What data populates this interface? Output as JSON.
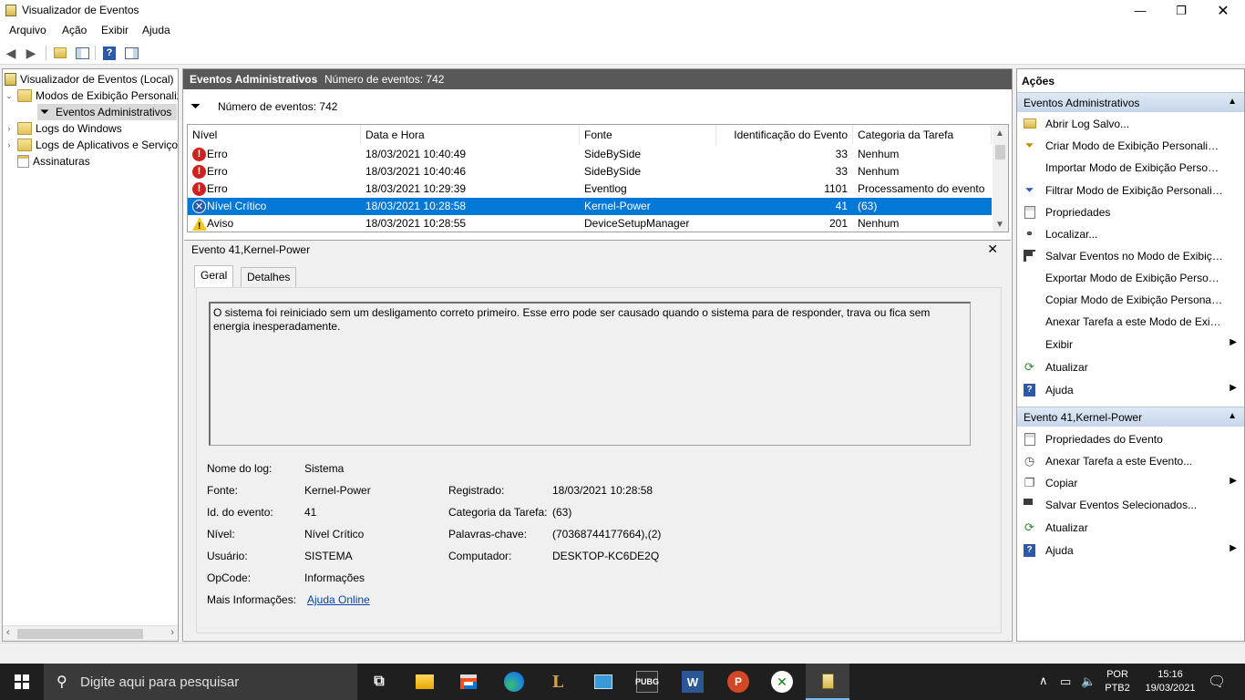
{
  "window": {
    "title": "Visualizador de Eventos",
    "minimize_icon": "minimize-icon",
    "maximize_icon": "restore-icon",
    "close_icon": "close-icon"
  },
  "menu": [
    "Arquivo",
    "Ação",
    "Exibir",
    "Ajuda"
  ],
  "tree": {
    "items": [
      {
        "label": "Visualizador de Eventos (Local)",
        "expander": ""
      },
      {
        "label": "Modos de Exibição Personalizados",
        "expander": "⌄"
      },
      {
        "label": "Eventos Administrativos",
        "expander": ""
      },
      {
        "label": "Logs do Windows",
        "expander": "›"
      },
      {
        "label": "Logs de Aplicativos e Serviços",
        "expander": "›"
      },
      {
        "label": "Assinaturas",
        "expander": ""
      }
    ]
  },
  "center": {
    "header_title": "Eventos Administrativos",
    "header_count": "Número de eventos: 742",
    "filter_text": "Número de eventos: 742",
    "columns": [
      "Nível",
      "Data e Hora",
      "Fonte",
      "Identificação do Evento",
      "Categoria da Tarefa"
    ],
    "rows": [
      {
        "level": "Erro",
        "datetime": "18/03/2021 10:40:49",
        "source": "SideBySide",
        "id": "33",
        "category": "Nenhum",
        "icon": "error-icon"
      },
      {
        "level": "Erro",
        "datetime": "18/03/2021 10:40:46",
        "source": "SideBySide",
        "id": "33",
        "category": "Nenhum",
        "icon": "error-icon"
      },
      {
        "level": "Erro",
        "datetime": "18/03/2021 10:29:39",
        "source": "Eventlog",
        "id": "1101",
        "category": "Processamento do evento",
        "icon": "error-icon"
      },
      {
        "level": "Nível Crítico",
        "datetime": "18/03/2021 10:28:58",
        "source": "Kernel-Power",
        "id": "41",
        "category": "(63)",
        "icon": "critical-icon"
      },
      {
        "level": "Aviso",
        "datetime": "18/03/2021 10:28:55",
        "source": "DeviceSetupManager",
        "id": "201",
        "category": "Nenhum",
        "icon": "warning-icon"
      }
    ]
  },
  "details": {
    "title": "Evento 41,Kernel-Power",
    "tabs": [
      "Geral",
      "Detalhes"
    ],
    "description": "O sistema foi reiniciado sem um desligamento correto primeiro. Esse erro pode ser causado quando o sistema para de responder, trava ou fica sem energia inesperadamente.",
    "fields": {
      "log_name_label": "Nome do log:",
      "log_name": "Sistema",
      "source_label": "Fonte:",
      "source": "Kernel-Power",
      "recorded_label": "Registrado:",
      "recorded": "18/03/2021 10:28:58",
      "event_id_label": "Id. do evento:",
      "event_id": "41",
      "task_category_label": "Categoria da Tarefa:",
      "task_category": "(63)",
      "level_label": "Nível:",
      "level": "Nível Crítico",
      "keywords_label": "Palavras-chave:",
      "keywords": "(70368744177664),(2)",
      "user_label": "Usuário:",
      "user": "SISTEMA",
      "computer_label": "Computador:",
      "computer": "DESKTOP-KC6DE2Q",
      "opcode_label": "OpCode:",
      "opcode": "Informações",
      "more_info_label": "Mais Informações:",
      "more_info_link": "Ajuda Online"
    }
  },
  "actions": {
    "title": "Ações",
    "section1": "Eventos Administrativos",
    "section1_items": [
      "Abrir Log Salvo...",
      "Criar Modo de Exibição Personalizado...",
      "Importar Modo de Exibição Personalizado...",
      "Filtrar Modo de Exibição Personalizado...",
      "Propriedades",
      "Localizar...",
      "Salvar Eventos no Modo de Exibição Personalizado...",
      "Exportar Modo de Exibição Personalizado...",
      "Copiar Modo de Exibição Personalizado...",
      "Anexar Tarefa a este Modo de Exibição Personalizado...",
      "Exibir",
      "Atualizar",
      "Ajuda"
    ],
    "section2": "Evento 41,Kernel-Power",
    "section2_items": [
      "Propriedades do Evento",
      "Anexar Tarefa a este Evento...",
      "Copiar",
      "Salvar Eventos Selecionados...",
      "Atualizar",
      "Ajuda"
    ]
  },
  "taskbar": {
    "search_placeholder": "Digite aqui para pesquisar",
    "lang_line1": "POR",
    "lang_line2": "PTB2",
    "time": "15:16",
    "date": "19/03/2021",
    "pubg_label": "PUBG",
    "word_label": "W",
    "ppt_label": "P",
    "colors": {
      "bar": "#1f1f1f",
      "accent": "#0078d7"
    }
  }
}
